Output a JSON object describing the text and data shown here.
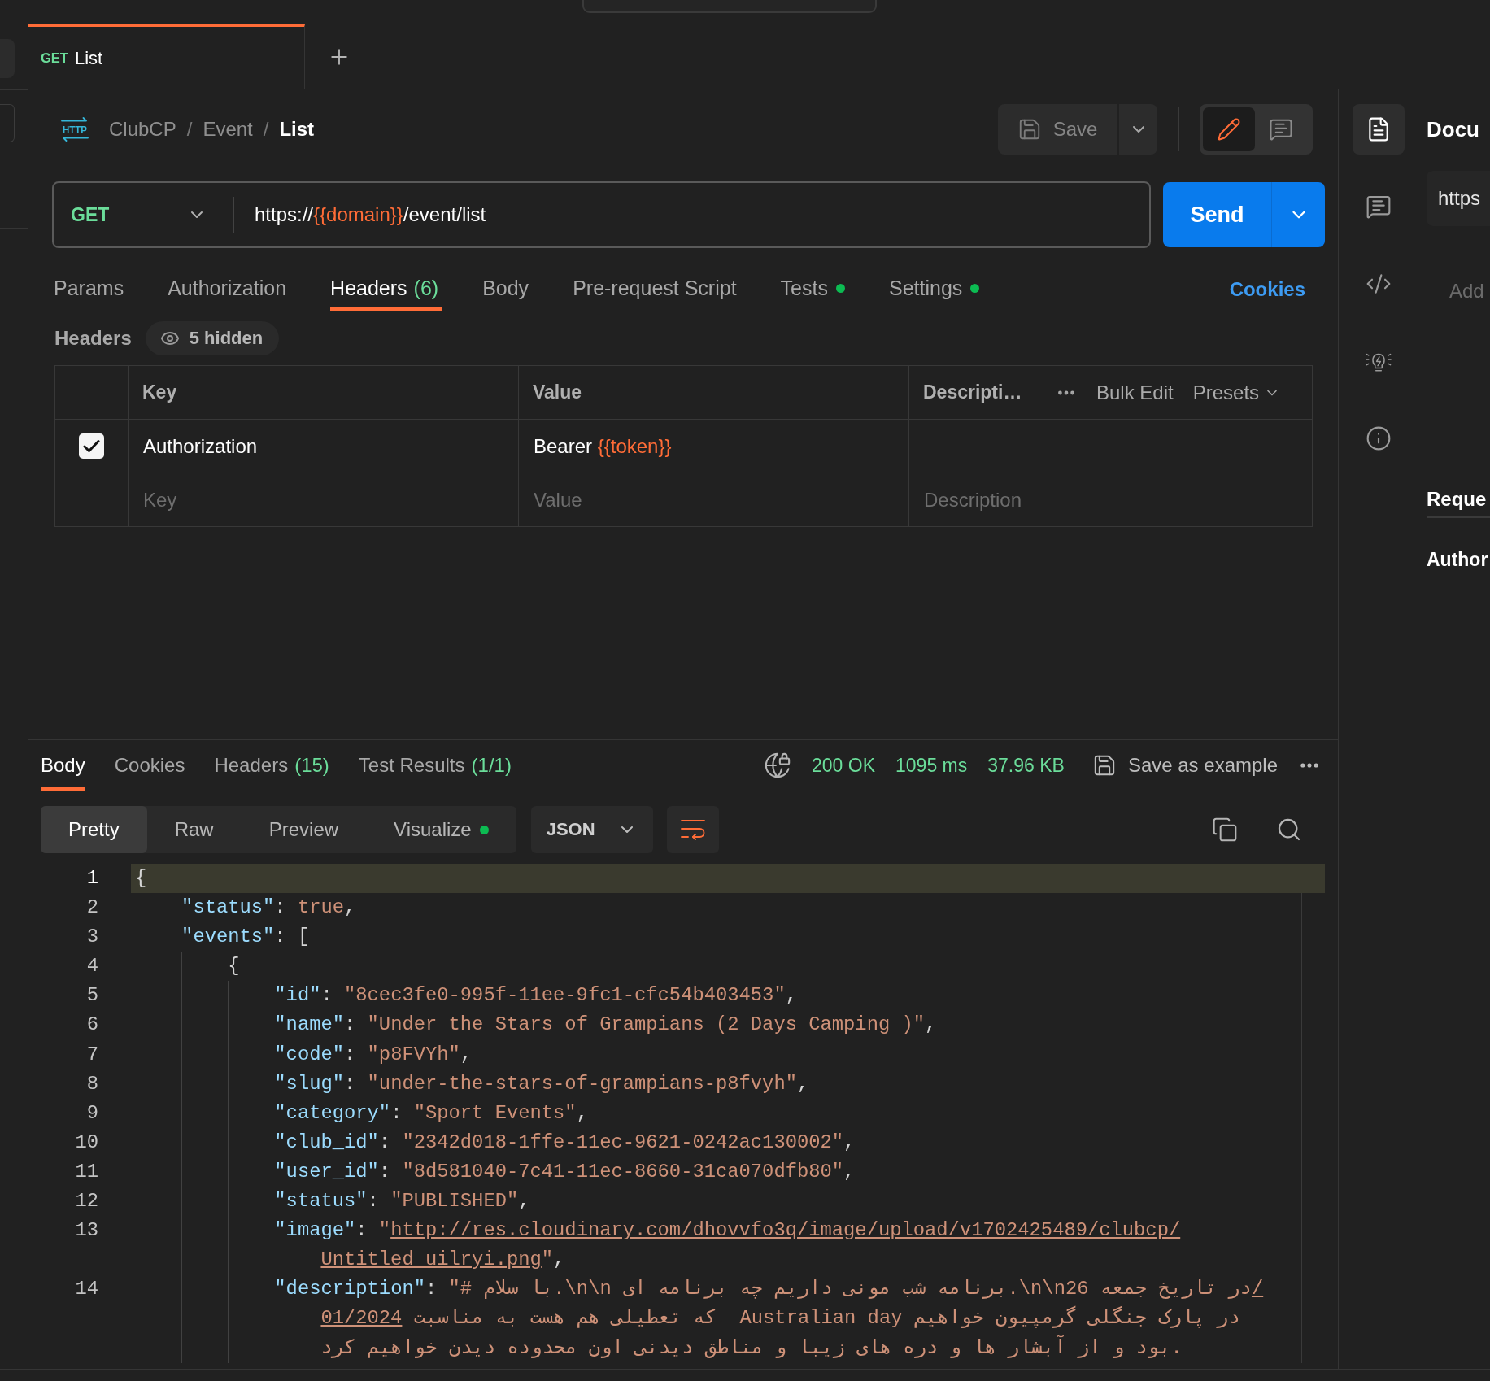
{
  "tabs": [
    {
      "method": "GET",
      "title": "List",
      "selected": true
    }
  ],
  "breadcrumb": {
    "icon_text": "HTTP",
    "parts": [
      {
        "kind": "crumb",
        "text": "ClubCP",
        "current": false
      },
      {
        "kind": "separator",
        "text": "/"
      },
      {
        "kind": "crumb",
        "text": "Event",
        "current": false
      },
      {
        "kind": "separator",
        "text": "/"
      },
      {
        "kind": "crumb",
        "text": "List",
        "current": true
      }
    ]
  },
  "actions": {
    "save": "Save",
    "modes": [
      {
        "kind": "edit",
        "selected": true
      },
      {
        "kind": "comments",
        "selected": false
      }
    ]
  },
  "request": {
    "method": "GET",
    "url": [
      {
        "kind": "text",
        "text": "https://"
      },
      {
        "kind": "variable",
        "text": "{{domain}}"
      },
      {
        "kind": "text",
        "text": "/event/list"
      }
    ],
    "send": "Send"
  },
  "request_tabs": [
    {
      "label": "Params",
      "selected": false,
      "indicator": false
    },
    {
      "label": "Authorization",
      "selected": false,
      "indicator": false
    },
    {
      "label": "Headers",
      "count": "(6)",
      "selected": true,
      "indicator": false
    },
    {
      "label": "Body",
      "selected": false,
      "indicator": false
    },
    {
      "label": "Pre-request Script",
      "selected": false,
      "indicator": false
    },
    {
      "label": "Tests",
      "selected": false,
      "indicator": true
    },
    {
      "label": "Settings",
      "selected": false,
      "indicator": true
    }
  ],
  "cookies_link": "Cookies",
  "headers": {
    "title": "Headers",
    "hidden": "5 hidden",
    "columns": [
      "Key",
      "Value",
      "Descripti…"
    ],
    "bulk_edit": "Bulk Edit",
    "presets": "Presets",
    "rows": [
      {
        "checked": true,
        "key": "Authorization",
        "value": [
          {
            "kind": "text",
            "text": "Bearer "
          },
          {
            "kind": "variable",
            "text": "{{token}}"
          }
        ]
      }
    ],
    "new_row": {
      "key": {
        "placeholder": "Key"
      },
      "value": {
        "placeholder": "Value"
      },
      "description": {
        "placeholder": "Description"
      }
    }
  },
  "response": {
    "tabs": [
      {
        "label": "Body",
        "selected": true
      },
      {
        "label": "Cookies",
        "selected": false
      },
      {
        "label": "Headers",
        "count": "(15)",
        "selected": false
      },
      {
        "label": "Test Results",
        "count": "(1/1)",
        "selected": false
      }
    ],
    "status": "200 OK",
    "time": "1095 ms",
    "size": "37.96 KB",
    "save_example": "Save as example",
    "views": [
      {
        "label": "Pretty",
        "selected": true,
        "indicator": false
      },
      {
        "label": "Raw",
        "selected": false,
        "indicator": false
      },
      {
        "label": "Preview",
        "selected": false,
        "indicator": false
      },
      {
        "label": "Visualize",
        "selected": false,
        "indicator": true
      }
    ],
    "format": "JSON",
    "code": [
      {
        "number": "1",
        "current": true,
        "segments": [
          {
            "tokens": [
              {
                "kind": "punct",
                "text": "{"
              }
            ]
          }
        ],
        "children": [
          {
            "number": "2",
            "current": false,
            "segments": [
              {
                "tokens": [
                  {
                    "kind": "key",
                    "text": "\"status\""
                  },
                  {
                    "kind": "punct",
                    "text": ": "
                  },
                  {
                    "kind": "literal",
                    "text": "true"
                  },
                  {
                    "kind": "punct",
                    "text": ","
                  }
                ]
              }
            ]
          },
          {
            "number": "3",
            "current": false,
            "segments": [
              {
                "tokens": [
                  {
                    "kind": "key",
                    "text": "\"events\""
                  },
                  {
                    "kind": "punct",
                    "text": ": ["
                  }
                ]
              }
            ],
            "children": [
              {
                "number": "4",
                "current": false,
                "segments": [
                  {
                    "tokens": [
                      {
                        "kind": "punct",
                        "text": "{"
                      }
                    ]
                  }
                ],
                "children": [
                  {
                    "number": "5",
                    "current": false,
                    "segments": [
                      {
                        "tokens": [
                          {
                            "kind": "key",
                            "text": "\"id\""
                          },
                          {
                            "kind": "punct",
                            "text": ": "
                          },
                          {
                            "kind": "string",
                            "text": "\"8cec3fe0-995f-11ee-9fc1-cfc54b403453\""
                          },
                          {
                            "kind": "punct",
                            "text": ","
                          }
                        ]
                      }
                    ]
                  },
                  {
                    "number": "6",
                    "current": false,
                    "segments": [
                      {
                        "tokens": [
                          {
                            "kind": "key",
                            "text": "\"name\""
                          },
                          {
                            "kind": "punct",
                            "text": ": "
                          },
                          {
                            "kind": "string",
                            "text": "\"Under the Stars of Grampians (2 Days Camping )\""
                          },
                          {
                            "kind": "punct",
                            "text": ","
                          }
                        ]
                      }
                    ]
                  },
                  {
                    "number": "7",
                    "current": false,
                    "segments": [
                      {
                        "tokens": [
                          {
                            "kind": "key",
                            "text": "\"code\""
                          },
                          {
                            "kind": "punct",
                            "text": ": "
                          },
                          {
                            "kind": "string",
                            "text": "\"p8FVYh\""
                          },
                          {
                            "kind": "punct",
                            "text": ","
                          }
                        ]
                      }
                    ]
                  },
                  {
                    "number": "8",
                    "current": false,
                    "segments": [
                      {
                        "tokens": [
                          {
                            "kind": "key",
                            "text": "\"slug\""
                          },
                          {
                            "kind": "punct",
                            "text": ": "
                          },
                          {
                            "kind": "string",
                            "text": "\"under-the-stars-of-grampians-p8fvyh\""
                          },
                          {
                            "kind": "punct",
                            "text": ","
                          }
                        ]
                      }
                    ]
                  },
                  {
                    "number": "9",
                    "current": false,
                    "segments": [
                      {
                        "tokens": [
                          {
                            "kind": "key",
                            "text": "\"category\""
                          },
                          {
                            "kind": "punct",
                            "text": ": "
                          },
                          {
                            "kind": "string",
                            "text": "\"Sport Events\""
                          },
                          {
                            "kind": "punct",
                            "text": ","
                          }
                        ]
                      }
                    ]
                  },
                  {
                    "number": "10",
                    "current": false,
                    "segments": [
                      {
                        "tokens": [
                          {
                            "kind": "key",
                            "text": "\"club_id\""
                          },
                          {
                            "kind": "punct",
                            "text": ": "
                          },
                          {
                            "kind": "string",
                            "text": "\"2342d018-1ffe-11ec-9621-0242ac130002\""
                          },
                          {
                            "kind": "punct",
                            "text": ","
                          }
                        ]
                      }
                    ]
                  },
                  {
                    "number": "11",
                    "current": false,
                    "segments": [
                      {
                        "tokens": [
                          {
                            "kind": "key",
                            "text": "\"user_id\""
                          },
                          {
                            "kind": "punct",
                            "text": ": "
                          },
                          {
                            "kind": "string",
                            "text": "\"8d581040-7c41-11ec-8660-31ca070dfb80\""
                          },
                          {
                            "kind": "punct",
                            "text": ","
                          }
                        ]
                      }
                    ]
                  },
                  {
                    "number": "12",
                    "current": false,
                    "segments": [
                      {
                        "tokens": [
                          {
                            "kind": "key",
                            "text": "\"status\""
                          },
                          {
                            "kind": "punct",
                            "text": ": "
                          },
                          {
                            "kind": "string",
                            "text": "\"PUBLISHED\""
                          },
                          {
                            "kind": "punct",
                            "text": ","
                          }
                        ]
                      }
                    ]
                  },
                  {
                    "number": "13",
                    "current": false,
                    "segments": [
                      {
                        "tokens": [
                          {
                            "kind": "key",
                            "text": "\"image\""
                          },
                          {
                            "kind": "punct",
                            "text": ": "
                          },
                          {
                            "kind": "string",
                            "text": "\""
                          },
                          {
                            "kind": "link",
                            "text": "http://res.cloudinary.com/dhovvfo3q/image/upload/v1702425489/clubcp/"
                          }
                        ]
                      },
                      {
                        "tokens": [
                          {
                            "kind": "link",
                            "text": "Untitled_uilryi.png"
                          },
                          {
                            "kind": "string",
                            "text": "\""
                          },
                          {
                            "kind": "punct",
                            "text": ","
                          }
                        ]
                      }
                    ]
                  },
                  {
                    "number": "14",
                    "current": false,
                    "segments": [
                      {
                        "tokens": [
                          {
                            "kind": "key",
                            "text": "\"description\""
                          },
                          {
                            "kind": "punct",
                            "text": ": "
                          },
                          {
                            "kind": "string",
                            "text": "\"# با سلام.\\n\\n برنامه شب مونی داریم چه برنامه ای.\\n\\nدر تاریخ جمعه 26"
                          },
                          {
                            "kind": "link",
                            "text": "/"
                          }
                        ]
                      },
                      {
                        "tokens": [
                          {
                            "kind": "link",
                            "text": "01/2024"
                          },
                          {
                            "kind": "string",
                            "text": " که تعطیلی هم هست به مناسبت  Australian day در پارک جنگلی گرمپیون خواهیم"
                          }
                        ]
                      },
                      {
                        "tokens": [
                          {
                            "kind": "string",
                            "text": "بود و از آبشار ها و دره های زیبا و مناطق دیدنی اون محدوده دیدن خواهیم کرد."
                          }
                        ]
                      }
                    ]
                  }
                ]
              }
            ]
          }
        ]
      }
    ]
  },
  "right_panel": {
    "tools": [
      {
        "kind": "docs",
        "selected": true
      },
      {
        "kind": "comments",
        "selected": false
      },
      {
        "kind": "code",
        "selected": false
      },
      {
        "kind": "ideas",
        "selected": false
      },
      {
        "kind": "info",
        "selected": false
      }
    ],
    "title": "Docu",
    "url": "https",
    "description": {
      "placeholder": "Add"
    },
    "section": "Reque",
    "subsection": "Author"
  }
}
